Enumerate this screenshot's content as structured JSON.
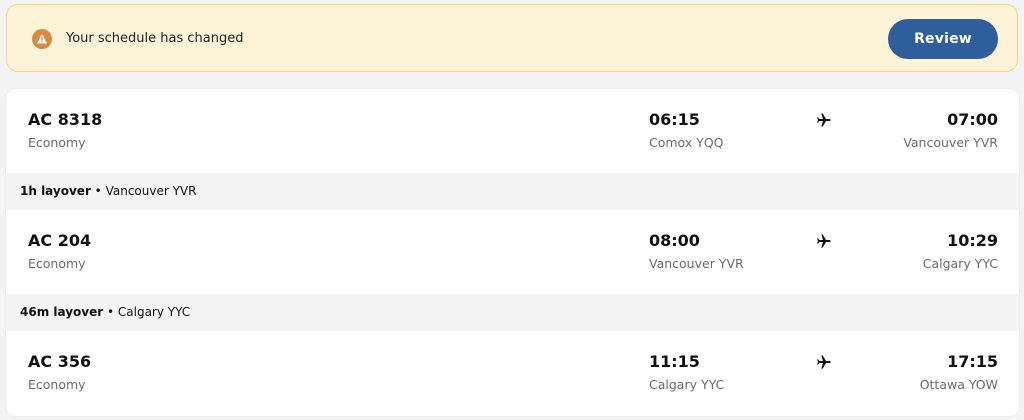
{
  "alert": {
    "message": "Your schedule has changed",
    "button_label": "Review",
    "icon": "warning-icon",
    "colors": {
      "background": "#fdf3d6",
      "border": "#f2d68a",
      "icon": "#d78a42",
      "button": "#2f5e9d"
    }
  },
  "itinerary": {
    "segments": [
      {
        "flight_number": "AC 8318",
        "cabin": "Economy",
        "departure_time": "06:15",
        "departure_airport": "Comox YQQ",
        "arrival_time": "07:00",
        "arrival_airport": "Vancouver YVR",
        "icon": "airplane-icon"
      },
      {
        "flight_number": "AC 204",
        "cabin": "Economy",
        "departure_time": "08:00",
        "departure_airport": "Vancouver YVR",
        "arrival_time": "10:29",
        "arrival_airport": "Calgary YYC",
        "icon": "airplane-icon"
      },
      {
        "flight_number": "AC 356",
        "cabin": "Economy",
        "departure_time": "11:15",
        "departure_airport": "Calgary YYC",
        "arrival_time": "17:15",
        "arrival_airport": "Ottawa YOW",
        "icon": "airplane-icon"
      }
    ],
    "layovers": [
      {
        "duration": "1h layover",
        "separator": " • ",
        "location": "Vancouver YVR"
      },
      {
        "duration": "46m layover",
        "separator": " • ",
        "location": "Calgary YYC"
      }
    ]
  }
}
